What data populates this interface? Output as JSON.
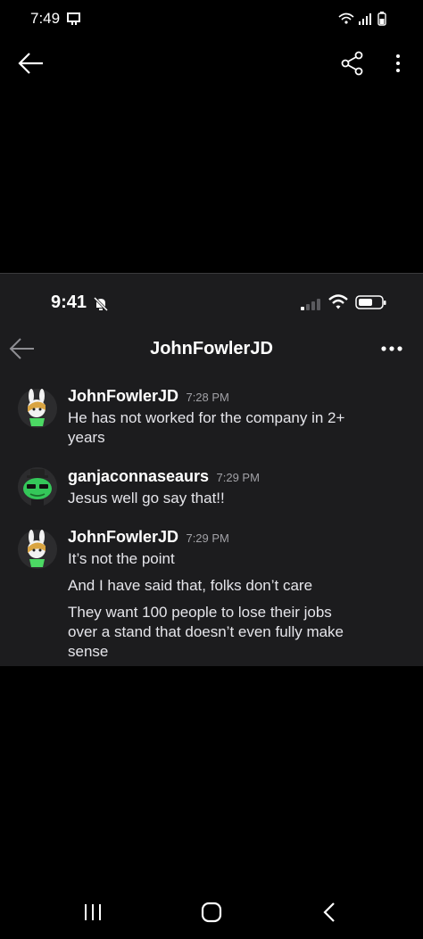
{
  "status_bar": {
    "time": "7:49",
    "icons": [
      "screen-mirror-icon",
      "wifi-icon",
      "signal-icon",
      "battery-icon"
    ]
  },
  "app_bar": {
    "icons": [
      "back-arrow-icon",
      "share-icon",
      "more-vert-icon"
    ]
  },
  "embedded_screenshot": {
    "status_bar": {
      "time": "9:41",
      "icons": [
        "bell-slash-icon",
        "cellular-signal-icon",
        "wifi-icon",
        "battery-icon"
      ]
    },
    "header": {
      "title": "JohnFowlerJD",
      "icons": [
        "back-arrow-icon",
        "more-horizontal-icon"
      ]
    },
    "messages": [
      {
        "author": "JohnFowlerJD",
        "time": "7:28 PM",
        "avatar": "bunny-avatar-icon",
        "lines": [
          "He has not worked for the company in 2+",
          "years"
        ]
      },
      {
        "author": "ganjaconnaseaurs",
        "time": "7:29 PM",
        "avatar": "green-frog-avatar-icon",
        "lines": [
          "Jesus well go say that!!"
        ]
      },
      {
        "author": "JohnFowlerJD",
        "time": "7:29 PM",
        "avatar": "bunny-avatar-icon",
        "lines": [
          "It’s not the point",
          "And I have said that, folks don’t care",
          "They want 100 people to lose their jobs",
          "over a stand that doesn’t even fully make",
          "sense"
        ]
      }
    ]
  },
  "nav_bar": {
    "icons": [
      "recents-icon",
      "home-icon",
      "back-icon"
    ]
  },
  "colors": {
    "background": "#000000",
    "embedded_background": "#1c1c1e",
    "text": "#ffffff",
    "secondary_text": "#a1a1a6"
  }
}
